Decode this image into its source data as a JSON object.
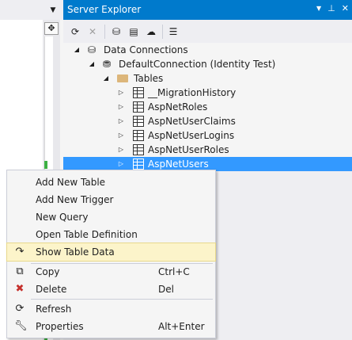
{
  "panel": {
    "title": "Server Explorer"
  },
  "title_icons": {
    "dropdown": "▼",
    "pin": "⊥",
    "close": "✕"
  },
  "toolbar": {
    "buttons": [
      {
        "name": "refresh-icon",
        "glyph": "⟳"
      },
      {
        "name": "stop-icon",
        "glyph": "✕"
      },
      {
        "name": "connect-to-database-icon",
        "glyph": "⛁"
      },
      {
        "name": "connect-to-server-icon",
        "glyph": "▤"
      },
      {
        "name": "azure-icon",
        "glyph": "☁"
      },
      {
        "name": "properties-icon",
        "glyph": "☰"
      }
    ]
  },
  "tree": {
    "data_connections": "Data Connections",
    "default_connection": "DefaultConnection (Identity Test)",
    "tables": "Tables",
    "table_items": [
      "__MigrationHistory",
      "AspNetRoles",
      "AspNetUserClaims",
      "AspNetUserLogins",
      "AspNetUserRoles",
      "AspNetUsers"
    ],
    "selected": "AspNetUsers"
  },
  "context_menu": {
    "items": [
      {
        "label": "Add New Table",
        "shortcut": ""
      },
      {
        "label": "Add New Trigger",
        "shortcut": ""
      },
      {
        "label": "New Query",
        "shortcut": ""
      },
      {
        "label": "Open Table Definition",
        "shortcut": ""
      },
      {
        "label": "Show Table Data",
        "shortcut": ""
      },
      {
        "label": "Copy",
        "shortcut": "Ctrl+C"
      },
      {
        "label": "Delete",
        "shortcut": "Del"
      },
      {
        "label": "Refresh",
        "shortcut": ""
      },
      {
        "label": "Properties",
        "shortcut": "Alt+Enter"
      }
    ],
    "highlighted": "Show Table Data"
  },
  "colors": {
    "accent": "#007acc",
    "selection": "#3399ff",
    "menu_highlight": "#fcf4ca",
    "delete_red": "#c5302c"
  }
}
